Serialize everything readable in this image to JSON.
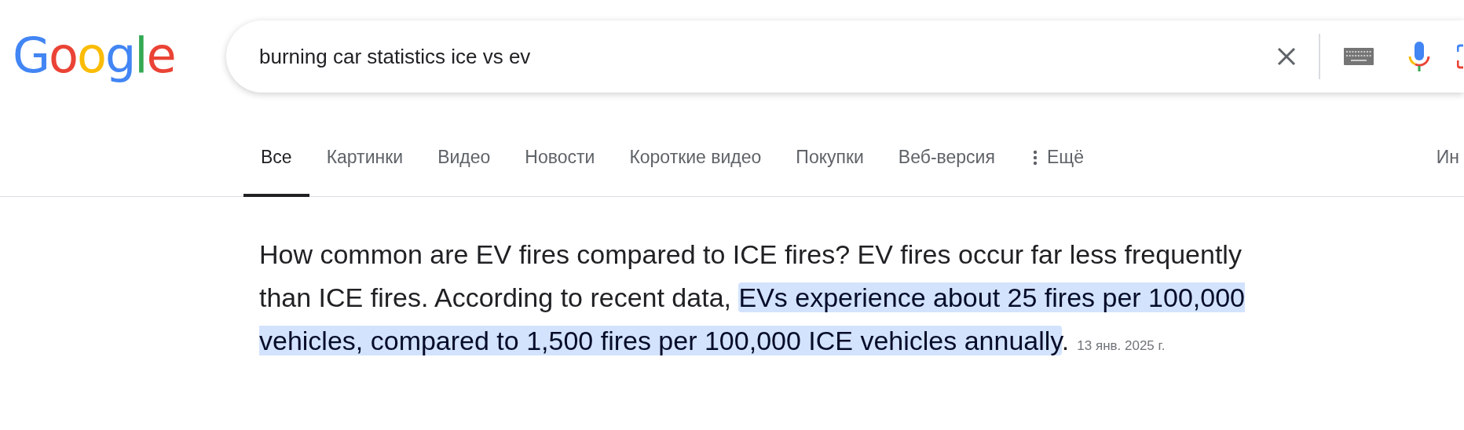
{
  "logo": "Google",
  "search": {
    "value": "burning car statistics ice vs ev"
  },
  "tabs": [
    {
      "label": "Все",
      "selected": true
    },
    {
      "label": "Картинки",
      "selected": false
    },
    {
      "label": "Видео",
      "selected": false
    },
    {
      "label": "Новости",
      "selected": false
    },
    {
      "label": "Короткие видео",
      "selected": false
    },
    {
      "label": "Покупки",
      "selected": false
    },
    {
      "label": "Веб-версия",
      "selected": false
    }
  ],
  "more_tab": "Ещё",
  "tools_tab": "Ин",
  "answer": {
    "text": "How common are EV fires compared to ICE fires? EV fires occur far less frequently than ICE fires. According to recent data, ",
    "highlight": "EVs experience about 25 fires per 100,000 vehicles, compared to 1,500 fires per 100,000 ICE vehicles annually",
    "text_after": ".",
    "date": "13 янв. 2025 г."
  }
}
